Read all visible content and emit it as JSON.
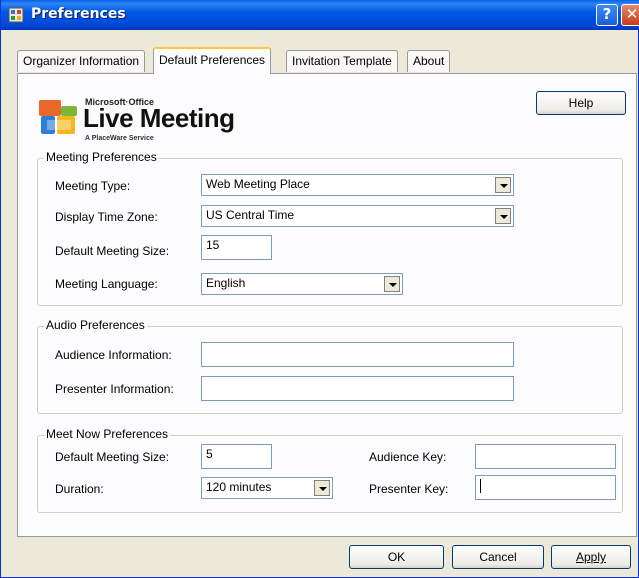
{
  "window": {
    "title": "Preferences",
    "help_glyph": "?",
    "close_glyph": "✕"
  },
  "tabs": [
    {
      "label": "Organizer Information",
      "active": false
    },
    {
      "label": "Default Preferences",
      "active": true
    },
    {
      "label": "Invitation Template",
      "active": false
    },
    {
      "label": "About",
      "active": false
    }
  ],
  "logo": {
    "top_text": "Microsoft·Office",
    "main_text": "Live Meeting",
    "sub_text": "A PlaceWare Service",
    "icon": "office-logo-icon"
  },
  "help_button_label": "Help",
  "meeting_preferences": {
    "title": "Meeting Preferences",
    "meeting_type": {
      "label": "Meeting Type:",
      "value": "Web Meeting Place"
    },
    "time_zone": {
      "label": "Display Time Zone:",
      "value": "US Central Time"
    },
    "meeting_size": {
      "label": "Default Meeting Size:",
      "value": "15"
    },
    "language": {
      "label": "Meeting Language:",
      "value": "English"
    }
  },
  "audio_preferences": {
    "title": "Audio Preferences",
    "audience_info": {
      "label": "Audience Information:",
      "value": ""
    },
    "presenter_info": {
      "label": "Presenter Information:",
      "value": ""
    }
  },
  "meet_now_preferences": {
    "title": "Meet Now Preferences",
    "meeting_size": {
      "label": "Default Meeting Size:",
      "value": "5"
    },
    "duration": {
      "label": "Duration:",
      "value": "120 minutes"
    },
    "audience_key": {
      "label": "Audience Key:",
      "value": ""
    },
    "presenter_key": {
      "label": "Presenter Key:",
      "value": ""
    }
  },
  "footer": {
    "ok": "OK",
    "cancel": "Cancel",
    "apply": "Apply"
  },
  "colors": {
    "titlebar": "#0058E6",
    "active_tab_accent": "#FFC83C",
    "window_bg": "#ECE9D8"
  }
}
